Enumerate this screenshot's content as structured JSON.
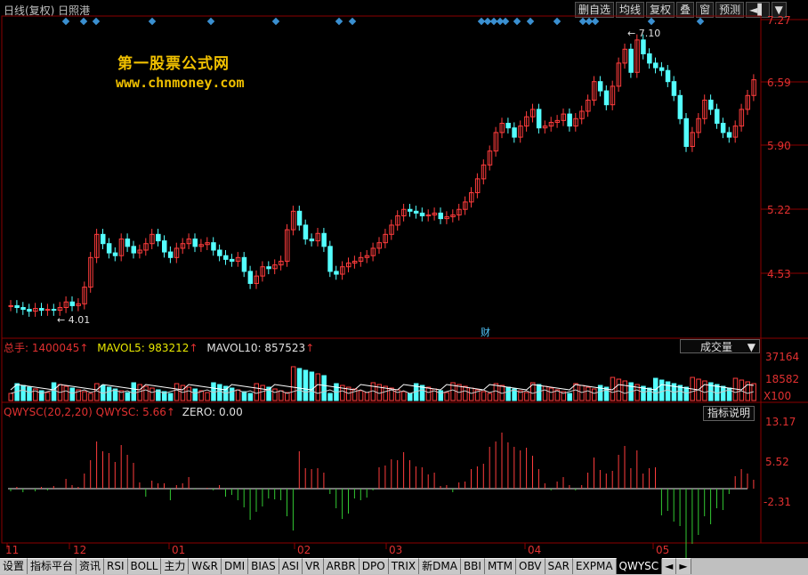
{
  "header": {
    "title": "日线(复权)  日照港"
  },
  "toolbar": {
    "items": [
      "删自选",
      "均线",
      "复权",
      "叠",
      "窗",
      "预测",
      "◄▌",
      "▼"
    ]
  },
  "watermark": {
    "title": "第一股票公式网",
    "url": "www.chnmoney.com"
  },
  "price_axis": {
    "labels": [
      "7.27",
      "6.59",
      "5.90",
      "5.22",
      "4.53"
    ]
  },
  "price_marks": {
    "high": "7.10",
    "low": "4.01",
    "cai": "财"
  },
  "volume_panel": {
    "total": "总手: 1400045",
    "mavol5": "MAVOL5: 983212",
    "mavol10": "MAVOL10: 857523",
    "dropdown": "成交量",
    "axis": [
      "37164",
      "18582",
      "X100"
    ]
  },
  "indicator_panel": {
    "name": "QWYSC(20,2,20)",
    "value": "QWYSC: 5.66",
    "zero": "ZERO: 0.00",
    "help": "指标说明",
    "axis": [
      "13.17",
      "5.52",
      "-2.31"
    ]
  },
  "date_axis": {
    "labels": [
      "11",
      "12",
      "01",
      "02",
      "03",
      "04",
      "05"
    ]
  },
  "tabs": [
    "设置",
    "指标平台",
    "资讯",
    "RSI",
    "BOLL",
    "主力",
    "W&R",
    "DMI",
    "BIAS",
    "ASI",
    "VR",
    "ARBR",
    "DPO",
    "TRIX",
    "新DMA",
    "BBI",
    "MTM",
    "OBV",
    "SAR",
    "EXPMA",
    "QWYSC",
    "◄",
    "►"
  ],
  "active_tab": "QWYSC",
  "colors": {
    "up": "#ff3c3c",
    "down": "#54ffff",
    "grid": "#8b0000",
    "ma_line": "#ffffff",
    "marker": "#3a8fd0"
  },
  "chart_data": {
    "type": "candlestick",
    "price_range": [
      4.53,
      7.27
    ],
    "closes": [
      4.18,
      4.16,
      4.14,
      4.12,
      4.15,
      4.13,
      4.14,
      4.13,
      4.16,
      4.22,
      4.18,
      4.2,
      4.38,
      4.7,
      4.95,
      4.85,
      4.75,
      4.72,
      4.9,
      4.82,
      4.75,
      4.78,
      4.85,
      4.95,
      4.88,
      4.76,
      4.7,
      4.8,
      4.85,
      4.9,
      4.82,
      4.84,
      4.86,
      4.78,
      4.72,
      4.68,
      4.66,
      4.7,
      4.55,
      4.42,
      4.5,
      4.6,
      4.58,
      4.62,
      4.66,
      5.0,
      5.2,
      5.05,
      4.9,
      4.88,
      4.96,
      4.82,
      4.55,
      4.52,
      4.6,
      4.64,
      4.66,
      4.7,
      4.72,
      4.8,
      4.86,
      4.95,
      5.05,
      5.15,
      5.22,
      5.2,
      5.18,
      5.15,
      5.16,
      5.18,
      5.12,
      5.14,
      5.16,
      5.22,
      5.3,
      5.4,
      5.55,
      5.7,
      5.85,
      6.05,
      6.15,
      6.1,
      6.0,
      6.12,
      6.22,
      6.3,
      6.1,
      6.12,
      6.16,
      6.18,
      6.25,
      6.12,
      6.2,
      6.28,
      6.4,
      6.6,
      6.5,
      6.35,
      6.55,
      6.8,
      6.95,
      6.7,
      7.05,
      6.9,
      6.8,
      6.75,
      6.72,
      6.6,
      6.45,
      6.2,
      5.9,
      6.05,
      6.2,
      6.4,
      6.3,
      6.15,
      6.05,
      6.0,
      6.12,
      6.3,
      6.45,
      6.62
    ]
  }
}
